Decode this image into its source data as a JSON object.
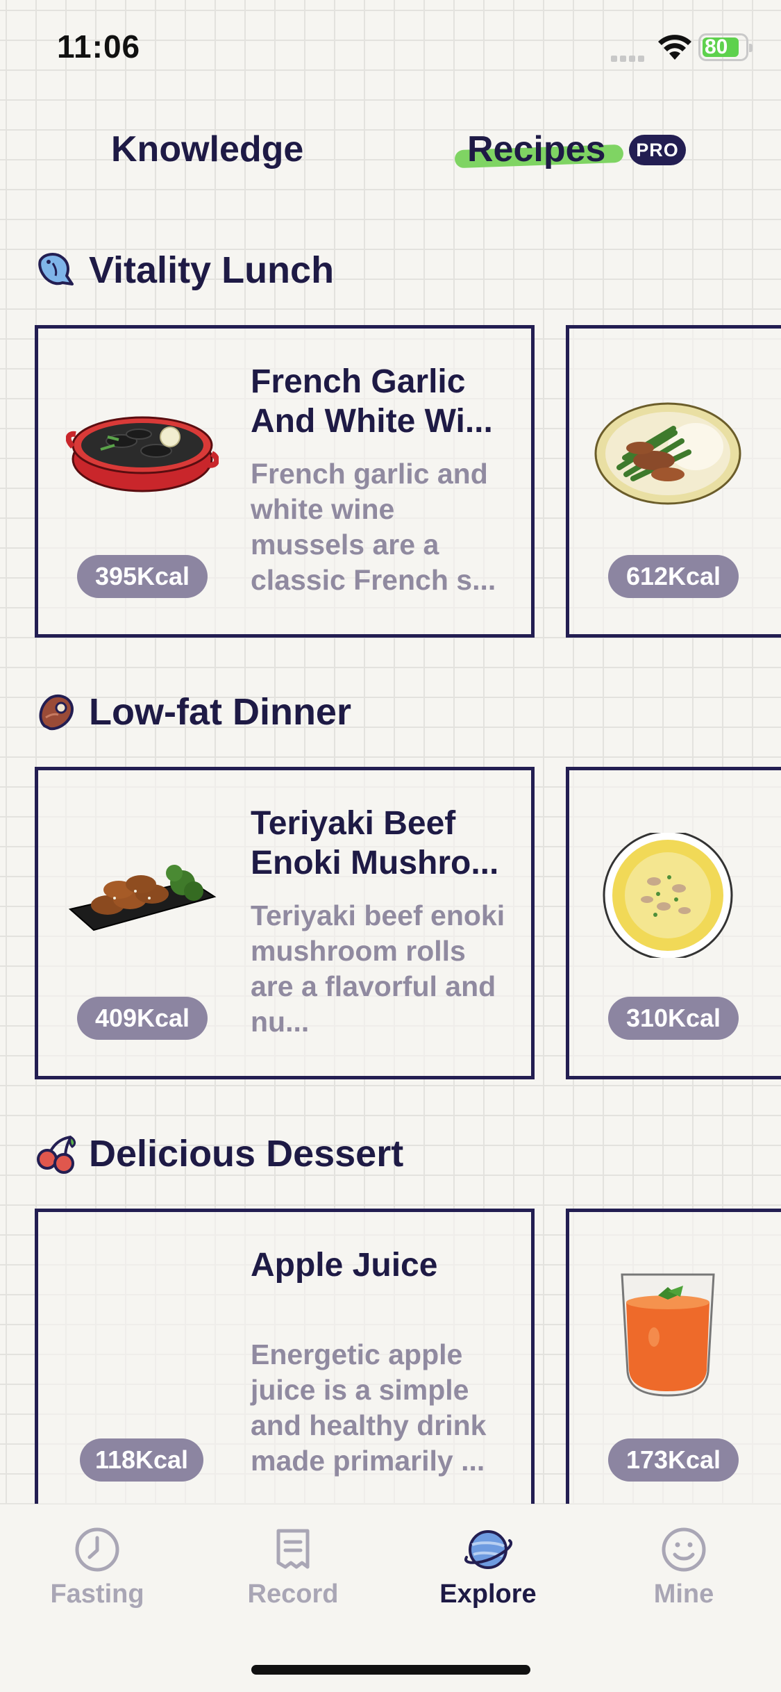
{
  "status_bar": {
    "time": "11:06",
    "battery": "80"
  },
  "top_tabs": {
    "knowledge": "Knowledge",
    "recipes": "Recipes",
    "pro_badge": "PRO",
    "active": "recipes"
  },
  "sections": [
    {
      "title": "Vitality Lunch",
      "icon": "fish-icon",
      "cards": [
        {
          "name": "French Garlic And White Wi...",
          "description": "French garlic and white wine mussels are a classic French s...",
          "kcal": "395Kcal",
          "image": "mussels-pot"
        },
        {
          "kcal": "612Kcal",
          "image": "asparagus-plate"
        }
      ]
    },
    {
      "title": "Low-fat Dinner",
      "icon": "steak-icon",
      "cards": [
        {
          "name": "Teriyaki Beef Enoki Mushro...",
          "description": "Teriyaki beef enoki mushroom rolls are a flavorful and nu...",
          "kcal": "409Kcal",
          "image": "beef-rolls"
        },
        {
          "kcal": "310Kcal",
          "image": "egg-bowl"
        }
      ]
    },
    {
      "title": "Delicious Dessert",
      "icon": "cherry-icon",
      "cards": [
        {
          "name": "Apple Juice",
          "description": "Energetic apple juice is a simple and healthy drink made primarily ...",
          "kcal": "118Kcal",
          "image": "none"
        },
        {
          "kcal": "173Kcal",
          "image": "juice-glass"
        }
      ]
    }
  ],
  "bottom_nav": [
    {
      "label": "Fasting",
      "icon": "clock-icon"
    },
    {
      "label": "Record",
      "icon": "notepad-icon"
    },
    {
      "label": "Explore",
      "icon": "planet-icon",
      "active": true
    },
    {
      "label": "Mine",
      "icon": "smiley-icon"
    }
  ]
}
